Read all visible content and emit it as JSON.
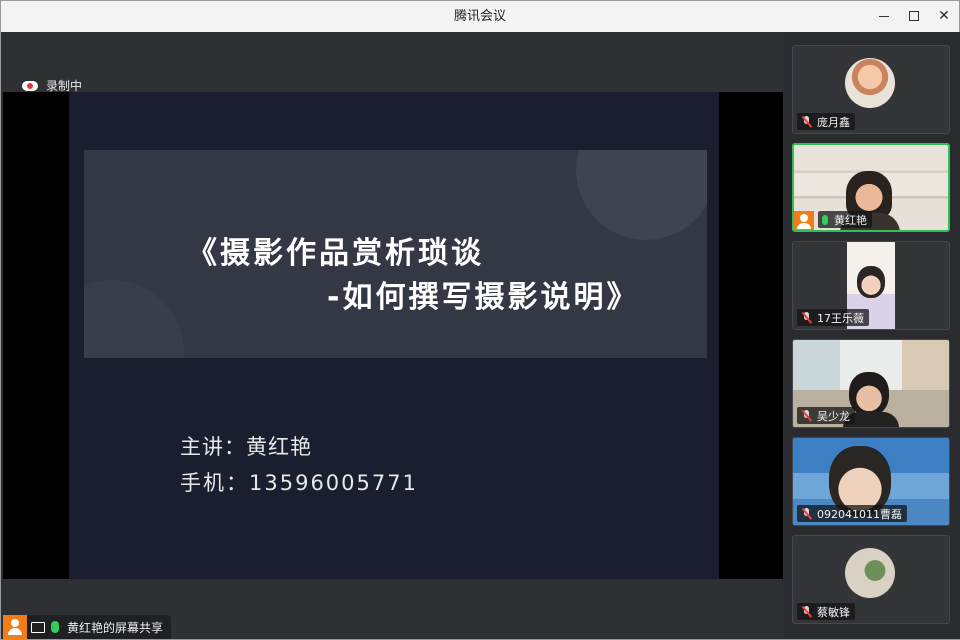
{
  "window": {
    "title": "腾讯会议"
  },
  "recording": {
    "label": "录制中"
  },
  "slide": {
    "title_line1": "《摄影作品赏析琐谈",
    "title_line2": "-如何撰写摄影说明》",
    "speaker": "主讲：黄红艳",
    "phone": "手机：13596005771"
  },
  "share": {
    "label": "黄红艳的屏幕共享"
  },
  "participants": [
    {
      "name": "庞月鑫",
      "mic": "muted"
    },
    {
      "name": "黄红艳",
      "mic": "on",
      "active": true
    },
    {
      "name": "17王乐薇",
      "mic": "muted"
    },
    {
      "name": "吴少龙",
      "mic": "muted"
    },
    {
      "name": "092041011曹磊",
      "mic": "muted"
    },
    {
      "name": "蔡敏锋",
      "mic": "muted"
    }
  ],
  "colors": {
    "accent": "#2fbf58",
    "record": "#e23a3a",
    "avatar": "#f07d1a"
  },
  "icons": [
    "record-cloud-icon",
    "minimize-icon",
    "maximize-icon",
    "close-icon",
    "user-icon",
    "screen-share-icon",
    "mic-icon",
    "mic-muted-icon"
  ]
}
